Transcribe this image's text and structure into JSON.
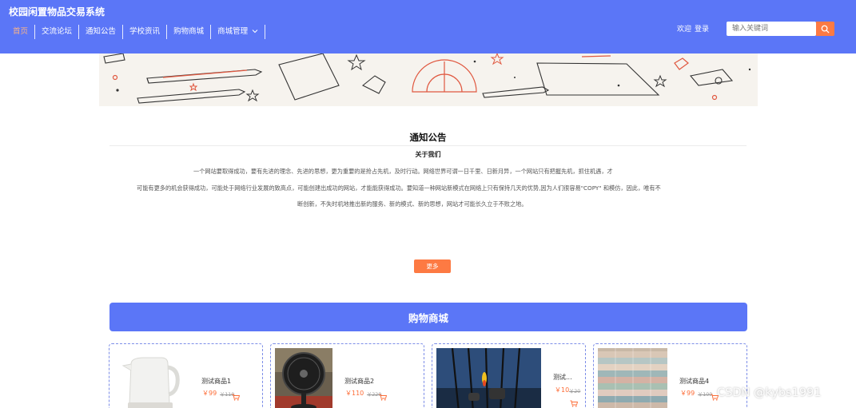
{
  "header": {
    "site_title": "校园闲置物品交易系统",
    "nav": [
      {
        "label": "首页",
        "active": true
      },
      {
        "label": "交流论坛"
      },
      {
        "label": "通知公告"
      },
      {
        "label": "学校资讯"
      },
      {
        "label": "购物商城"
      },
      {
        "label": "商城管理",
        "has_dropdown": true
      }
    ],
    "welcome": "欢迎",
    "login": "登录",
    "search_placeholder": "输入关键词",
    "search_icon": "search-icon"
  },
  "notice": {
    "title": "通知公告",
    "subtitle": "关于我们",
    "paragraph_lines": [
      "一个网站要取得成功，要有先进的理念、先进的思想，更为重要的是抢占先机，及时行动。网络世界可谓一日千里、日新月异，一个网站只有把握先机，抓住机遇，才",
      "可能有更多的机会获得成功，可能处于网络行业发展的致高点，可能创建出成功的网站，才能能获得成功。要知道一种网站新模式在网络上只有保持几天的优势,因为人们很容易\"COPY\" 和模仿，因此，唯有不",
      "断创新，不失时机地推出新的服务、新的模式、新的思想，网站才可能长久立于不败之地。"
    ],
    "more_label": "更多"
  },
  "shop": {
    "title": "购物商城",
    "products": [
      {
        "name": "测试商品1",
        "price": "￥99",
        "old_price": "￥110"
      },
      {
        "name": "测试商品2",
        "price": "￥110",
        "old_price": "￥220"
      },
      {
        "name": "测试...",
        "price": "￥10",
        "old_price": "￥20"
      },
      {
        "name": "测试商品4",
        "price": "￥99",
        "old_price": "￥100"
      }
    ]
  },
  "watermark": "CSDN @kybs1991",
  "colors": {
    "header_bg": "#5b76f7",
    "accent_orange": "#fd7a43",
    "price_orange": "#fd6b35",
    "card_border": "#7d8ee8"
  }
}
